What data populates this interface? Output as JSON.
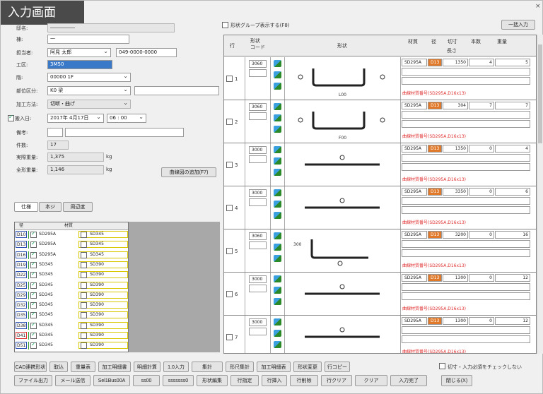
{
  "window": {
    "title": "入力画面",
    "close": "×"
  },
  "form": {
    "fields": [
      {
        "label": "邸名:",
        "value": "―――――",
        "ro": true
      },
      {
        "label": "棟:",
        "value": "一",
        "ro": false
      },
      {
        "label": "担当者:",
        "value": "阿見 太郎",
        "extra": "049-0000-0000"
      },
      {
        "label": "工区:",
        "value": "3M50",
        "sel": true
      },
      {
        "label": "階:",
        "value": "00000   1F"
      },
      {
        "label": "部位区分:",
        "value": "K0    梁"
      },
      {
        "label": "加工方法:",
        "value": "切断・曲げ",
        "ro": true
      },
      {
        "label": "搬入日:",
        "value": "2017年 4月17日",
        "time": "06 : 00"
      },
      {
        "label": "備考:",
        "value": ""
      },
      {
        "label": "件数:",
        "value": "17",
        "ro": true
      },
      {
        "label": "実際重量:",
        "value": "1,375",
        "unit": "kg",
        "ro": true
      },
      {
        "label": "全形重量:",
        "value": "1,146",
        "unit": "kg",
        "ro": true
      }
    ],
    "schedule_button": "曲線図の追加(F7)",
    "tabs": [
      "仕様",
      "本ジ",
      "周辺度"
    ],
    "mat_headers": [
      "径",
      "材質"
    ],
    "mat_rows": [
      {
        "d": "D10",
        "m1": "SD295A",
        "m2": "SD345",
        "red": false
      },
      {
        "d": "D13",
        "m1": "SD295A",
        "m2": "SD345",
        "red": false
      },
      {
        "d": "D16",
        "m1": "SD295A",
        "m2": "SD345",
        "red": false
      },
      {
        "d": "D19",
        "m1": "SD345",
        "m2": "SD390",
        "red": false
      },
      {
        "d": "D22",
        "m1": "SD345",
        "m2": "SD390",
        "red": false
      },
      {
        "d": "D25",
        "m1": "SD345",
        "m2": "SD390",
        "red": false
      },
      {
        "d": "D29",
        "m1": "SD345",
        "m2": "SD390",
        "red": false
      },
      {
        "d": "D32",
        "m1": "SD345",
        "m2": "SD390",
        "red": false
      },
      {
        "d": "D35",
        "m1": "SD345",
        "m2": "SD390",
        "red": false
      },
      {
        "d": "D38",
        "m1": "SD345",
        "m2": "SD390",
        "red": false
      },
      {
        "d": "D41",
        "m1": "SD345",
        "m2": "SD390",
        "red": true
      },
      {
        "d": "D51",
        "m1": "SD345",
        "m2": "SD390",
        "red": false
      }
    ]
  },
  "grid": {
    "group_toggle": "形状グループ表示する(F8)",
    "bulk_button": "一括入力",
    "headers": {
      "no": "行",
      "code": "形状\nコード",
      "shape": "形状",
      "mat": "材質",
      "dia": "径",
      "len": "切寸",
      "qty": "本数",
      "wt": "重量",
      "len2": "長さ"
    },
    "rows": [
      {
        "no": "1",
        "code": "3060",
        "mat": "SD295A",
        "dia": "D13",
        "len": "1350",
        "qty": "4",
        "wt": "5",
        "note": "曲線材質番号(SD295A,D16x13)",
        "shape_label": "L00"
      },
      {
        "no": "2",
        "code": "3060",
        "mat": "SD295A",
        "dia": "D13",
        "len": "304",
        "qty": "7",
        "wt": "7",
        "note": "曲線材質番号(SD295A,D16x13)",
        "shape_label": "F00"
      },
      {
        "no": "3",
        "code": "3000",
        "mat": "SD295A",
        "dia": "D13",
        "len": "1350",
        "qty": "0",
        "wt": "4",
        "note": "曲線材質番号(SD295A,D16x13)",
        "shape_label": ""
      },
      {
        "no": "4",
        "code": "3000",
        "mat": "SD295A",
        "dia": "D13",
        "len": "3350",
        "qty": "0",
        "wt": "6",
        "note": "曲線材質番号(SD295A,D16x13)",
        "shape_label": ""
      },
      {
        "no": "5",
        "code": "3060",
        "mat": "SD295A",
        "dia": "D13",
        "len": "3200",
        "qty": "0",
        "wt": "16",
        "note": "曲線材質番号(SD295A,D16x13)",
        "shape_label": "300"
      },
      {
        "no": "6",
        "code": "3000",
        "mat": "SD295A",
        "dia": "D13",
        "len": "1300",
        "qty": "0",
        "wt": "12",
        "note": "曲線材質番号(SD295A,D16x13)",
        "shape_label": ""
      },
      {
        "no": "7",
        "code": "3000",
        "mat": "SD295A",
        "dia": "D13",
        "len": "1300",
        "qty": "0",
        "wt": "12",
        "note": "曲線材質番号(SD295A,D16x13)",
        "shape_label": ""
      }
    ]
  },
  "bottom": {
    "row1": [
      "CAD連携形状",
      "取込",
      "重量表",
      "加工明細書",
      "明細計算",
      "1.0入力",
      "集計",
      "形尺集計",
      "加工明細表",
      "形状変更",
      "行コピー"
    ],
    "check_label": "切寸・入力必須をチェックしない",
    "row2": [
      "ファイル出力",
      "メール送信",
      "Sel1Bus00A",
      "ss00",
      "sssssss0",
      "形状編集",
      "行指定",
      "行挿入",
      "行削除",
      "行クリア",
      "クリア",
      "入力完了",
      "閉じる(X)"
    ]
  }
}
